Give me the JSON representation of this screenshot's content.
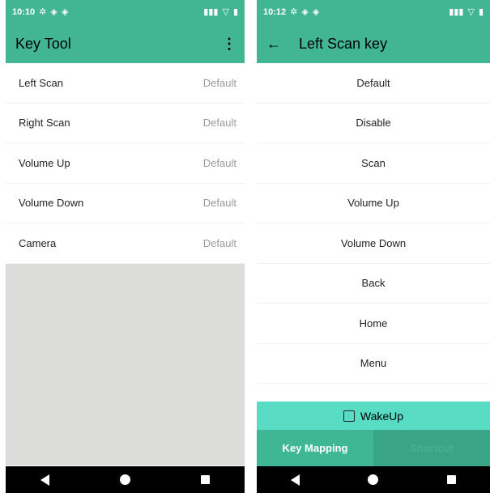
{
  "left_screen": {
    "status": {
      "time": "10:10"
    },
    "app_title": "Key Tool",
    "menu_glyph": "⋮",
    "keys": [
      {
        "label": "Left Scan",
        "value": "Default"
      },
      {
        "label": "Right Scan",
        "value": "Default"
      },
      {
        "label": "Volume Up",
        "value": "Default"
      },
      {
        "label": "Volume Down",
        "value": "Default"
      },
      {
        "label": "Camera",
        "value": "Default"
      }
    ]
  },
  "right_screen": {
    "status": {
      "time": "10:12"
    },
    "title": "Left Scan key",
    "back_glyph": "←",
    "options": [
      "Default",
      "Disable",
      "Scan",
      "Volume Up",
      "Volume Down",
      "Back",
      "Home",
      "Menu"
    ],
    "wakeup_label": "WakeUp",
    "tabs": [
      "Key Mapping",
      "Shortcut"
    ]
  },
  "icons": {
    "status": [
      "settings-icon",
      "location-icon",
      "location-icon",
      "battery-icon",
      "wifi-icon",
      "signal-icon"
    ],
    "nav": [
      "nav-back-icon",
      "nav-home-icon",
      "nav-recents-icon"
    ]
  },
  "colors": {
    "accent": "#42b593",
    "wakeup_bg": "#59dcc4",
    "tab_active": "#3fb795",
    "tab_inactive": "#39a486",
    "disabled_area": "#dcdcda"
  }
}
